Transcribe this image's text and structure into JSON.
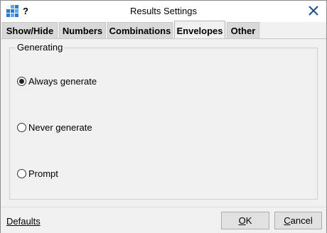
{
  "window": {
    "title": "Results Settings",
    "help_label": "?",
    "app_icon": "grid-app-icon",
    "close_icon": "close-icon"
  },
  "tabs": [
    {
      "label": "Show/Hide",
      "active": false
    },
    {
      "label": "Numbers",
      "active": false
    },
    {
      "label": "Combinations",
      "active": false
    },
    {
      "label": "Envelopes",
      "active": true
    },
    {
      "label": "Other",
      "active": false
    }
  ],
  "group": {
    "title": "Generating",
    "options": [
      {
        "label": "Always generate",
        "checked": true
      },
      {
        "label": "Never generate",
        "checked": false
      },
      {
        "label": "Prompt",
        "checked": false
      }
    ]
  },
  "footer": {
    "defaults_label": "Defaults",
    "ok_mnemonic": "O",
    "ok_rest": "K",
    "cancel_mnemonic": "C",
    "cancel_rest": "ancel"
  }
}
